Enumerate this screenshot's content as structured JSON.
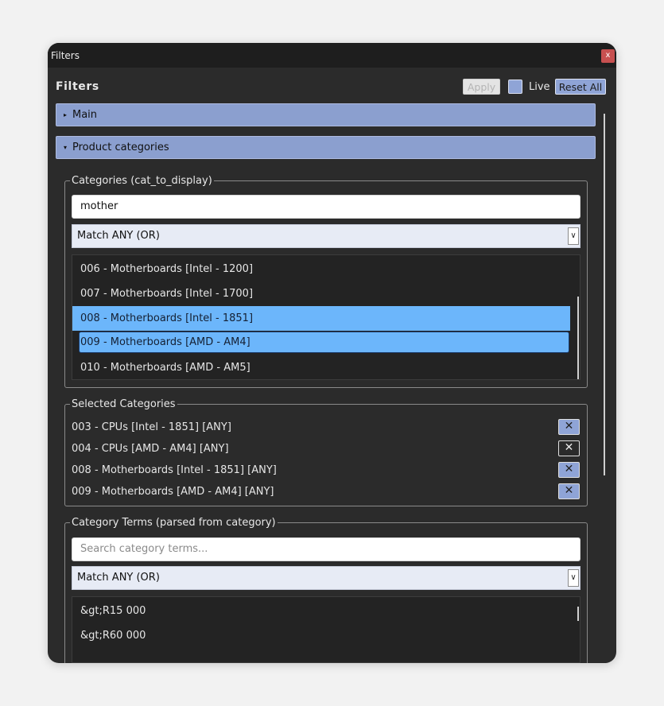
{
  "window": {
    "title": "Filters",
    "close_label": "x"
  },
  "header": {
    "title": "Filters",
    "apply_label": "Apply",
    "live_label": "Live",
    "reset_label": "Reset All"
  },
  "sections": {
    "main": "Main",
    "product_categories": "Product categories",
    "collapsed_glyph": "▸",
    "expanded_glyph": "▾"
  },
  "categories": {
    "legend": "Categories (cat_to_display)",
    "search_value": "mother",
    "match_mode": "Match ANY (OR)",
    "items": [
      {
        "label": "006 - Motherboards [Intel - 1200]",
        "selected": false
      },
      {
        "label": "007 - Motherboards [Intel - 1700]",
        "selected": false
      },
      {
        "label": "008 - Motherboards [Intel - 1851]",
        "selected": true
      },
      {
        "label": "009 - Motherboards [AMD - AM4]",
        "selected": true
      },
      {
        "label": "010 - Motherboards [AMD - AM5]",
        "selected": false
      }
    ]
  },
  "selected_categories": {
    "legend": "Selected Categories",
    "rows": [
      {
        "label": "003 - CPUs [Intel - 1851]  [ANY]",
        "remove_glyph": "✕"
      },
      {
        "label": "004 - CPUs [AMD - AM4]  [ANY]",
        "remove_glyph": "✕"
      },
      {
        "label": "008 - Motherboards [Intel - 1851]  [ANY]",
        "remove_glyph": "✕"
      },
      {
        "label": "009 - Motherboards [AMD - AM4]  [ANY]",
        "remove_glyph": "✕"
      }
    ]
  },
  "category_terms": {
    "legend": "Category Terms (parsed from category)",
    "search_placeholder": "Search category terms...",
    "match_mode": "Match ANY (OR)",
    "items": [
      "&gt;R15 000",
      "&gt;R60 000"
    ]
  },
  "colors": {
    "accent": "#8b9fcf",
    "selection": "#6cb6fb",
    "window_bg": "#2b2b2b",
    "close": "#c75050"
  }
}
